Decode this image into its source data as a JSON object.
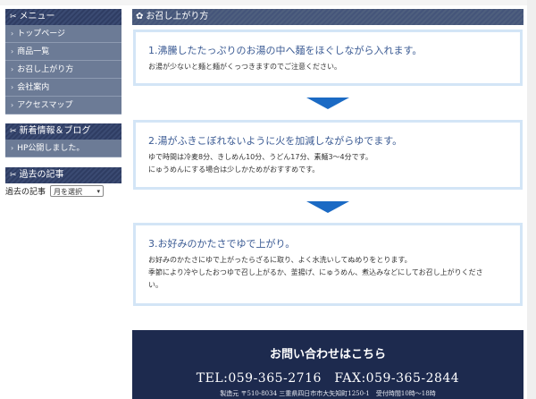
{
  "header_fragment": "—— ——",
  "sidebar": {
    "menu_title": "メニュー",
    "menu_items": [
      {
        "label": "トップページ"
      },
      {
        "label": "商品一覧"
      },
      {
        "label": "お召し上がり方"
      },
      {
        "label": "会社案内"
      },
      {
        "label": "アクセスマップ"
      }
    ],
    "news_title": "新着情報＆ブログ",
    "news_items": [
      {
        "label": "HP公開しました。"
      }
    ],
    "archive_title": "過去の記事",
    "archive_label": "過去の記事",
    "archive_select": "月を選択"
  },
  "main": {
    "heading": "お召し上がり方",
    "steps": [
      {
        "title": "1.沸騰したたっぷりのお湯の中へ麺をほぐしながら入れます。",
        "lines": [
          "お湯が少ないと麺と麺がくっつきますのでご注意ください。"
        ]
      },
      {
        "title": "2.湯がふきこぼれないように火を加減しながらゆでます。",
        "lines": [
          "ゆで時間は冷麦8分、きしめん10分、うどん17分、素麺3〜4分です。",
          "にゅうめんにする場合は少しかためがおすすめです。"
        ]
      },
      {
        "title": "3.お好みのかたさでゆで上がり。",
        "lines": [
          "お好みのかたさにゆで上がったらざるに取り、よく水洗いしてぬめりをとります。",
          "季節により冷やしたおつゆで召し上がるか、釜揚げ、にゅうめん、煮込みなどにしてお召し上がりくださ",
          "い。"
        ]
      }
    ]
  },
  "contact": {
    "title": "お問い合わせはこちら",
    "tel": "TEL:059-365-2716　FAX:059-365-2844",
    "address": "製造元 〒510-8034 三重県四日市市大矢知町1250-1　受付時間10時〜18時"
  },
  "colors": {
    "sidebar_item": "#6c7b96",
    "heading_band": "#3a4a72",
    "step_border": "#d3e5f6",
    "step_title": "#3a5a93",
    "arrow": "#1b6ac4",
    "contact_bg": "#1d2a4e"
  }
}
